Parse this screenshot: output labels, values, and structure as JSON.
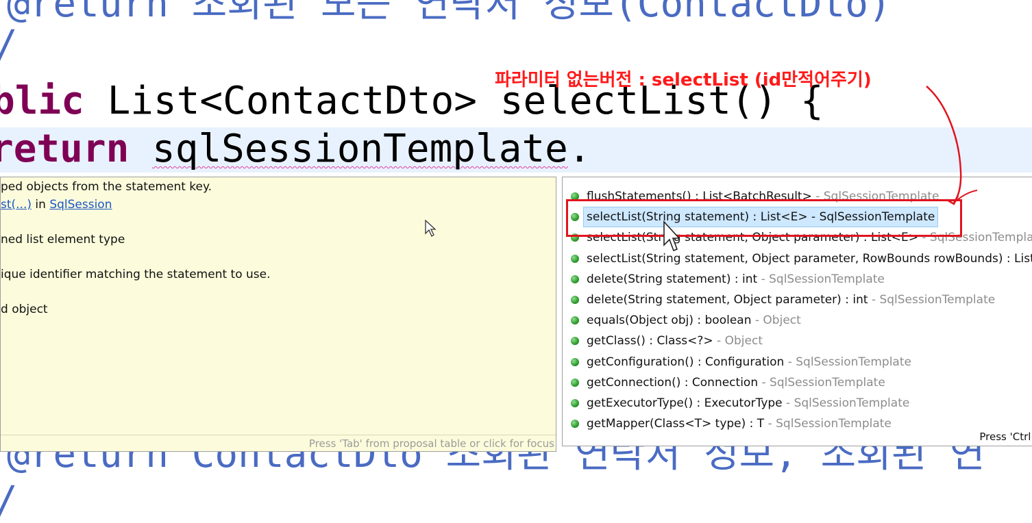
{
  "editor": {
    "comment_top": "@return 조회된 모든 연락처 정보(ContactDto)",
    "comment_slash_1": "/",
    "sig_part1": "blic",
    "sig_part2": " List<ContactDto> selectList() {",
    "return_kw": "return",
    "return_space": " ",
    "return_expr": "sqlSessionTemplate",
    "return_dot": ".",
    "comment_bottom": "@return ContactDto 조회된 연락처 정보, 조회된 연",
    "comment_slash_2": "/"
  },
  "doc_popup": {
    "line1": "ped objects from the statement key.",
    "line2_link": "st(...)",
    "line2_mid": " in ",
    "line2_link2": "SqlSession",
    "line3": "ned list element type",
    "line4": "ique identifier matching the statement to use.",
    "line5": "d object",
    "status": "Press 'Tab' from proposal table or click for focus"
  },
  "proposals": {
    "items": [
      {
        "sig": "flushStatements() : List<BatchResult>",
        "src": " - SqlSessionTemplate"
      },
      {
        "sig": "selectList(String statement) : List<E> - SqlSessionTemplate",
        "src": ""
      },
      {
        "sig": "selectList(String statement, Object parameter) : List<E>",
        "src": " - SqlSessionTemplate"
      },
      {
        "sig": "selectList(String statement, Object parameter, RowBounds rowBounds) : List",
        "src": ""
      },
      {
        "sig": "delete(String statement) : int",
        "src": " - SqlSessionTemplate"
      },
      {
        "sig": "delete(String statement, Object parameter) : int",
        "src": " - SqlSessionTemplate"
      },
      {
        "sig": "equals(Object obj) : boolean",
        "src": " - Object"
      },
      {
        "sig": "getClass() : Class<?>",
        "src": " - Object"
      },
      {
        "sig": "getConfiguration() : Configuration",
        "src": " - SqlSessionTemplate"
      },
      {
        "sig": "getConnection() : Connection",
        "src": " - SqlSessionTemplate"
      },
      {
        "sig": "getExecutorType() : ExecutorType",
        "src": " - SqlSessionTemplate"
      },
      {
        "sig": "getMapper(Class<T> type) : T",
        "src": " - SqlSessionTemplate"
      }
    ],
    "selected_index": 1,
    "status": "Press 'Ctrl+"
  },
  "annotation": {
    "text": "파라미터 없는버전 : selectList (id만적어주기)",
    "color": "#ff1a1a"
  }
}
